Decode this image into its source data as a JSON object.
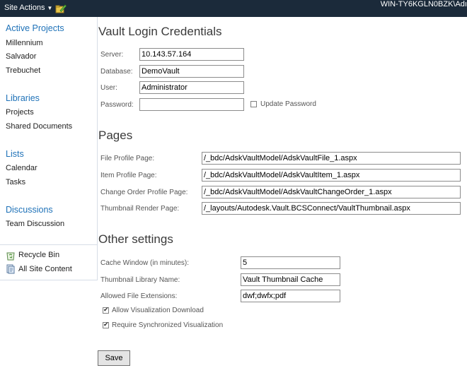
{
  "topbar": {
    "site_actions_label": "Site Actions",
    "server_name": "WIN-TY6KGLN0BZK\\Adı"
  },
  "leftnav": {
    "groups": [
      {
        "heading": "Active Projects",
        "items": [
          "Millennium",
          "Salvador",
          "Trebuchet"
        ]
      },
      {
        "heading": "Libraries",
        "items": [
          "Projects",
          "Shared Documents"
        ]
      },
      {
        "heading": "Lists",
        "items": [
          "Calendar",
          "Tasks"
        ]
      },
      {
        "heading": "Discussions",
        "items": [
          "Team Discussion"
        ]
      }
    ],
    "bottom": {
      "recycle_bin": "Recycle Bin",
      "all_site_content": "All Site Content"
    }
  },
  "vault": {
    "title": "Vault Login Credentials",
    "server_label": "Server:",
    "server_value": "10.143.57.164",
    "database_label": "Database:",
    "database_value": "DemoVault",
    "user_label": "User:",
    "user_value": "Administrator",
    "password_label": "Password:",
    "password_value": "",
    "update_password_label": "Update Password",
    "update_password_checked": false
  },
  "pages": {
    "title": "Pages",
    "file_profile_label": "File Profile Page:",
    "file_profile_value": "/_bdc/AdskVaultModel/AdskVaultFile_1.aspx",
    "item_profile_label": "Item Profile Page:",
    "item_profile_value": "/_bdc/AdskVaultModel/AdskVaultItem_1.aspx",
    "change_order_label": "Change Order Profile Page:",
    "change_order_value": "/_bdc/AdskVaultModel/AdskVaultChangeOrder_1.aspx",
    "thumbnail_render_label": "Thumbnail Render Page:",
    "thumbnail_render_value": "/_layouts/Autodesk.Vault.BCSConnect/VaultThumbnail.aspx"
  },
  "other": {
    "title": "Other settings",
    "cache_window_label": "Cache Window (in minutes):",
    "cache_window_value": "5",
    "thumbnail_library_label": "Thumbnail Library Name:",
    "thumbnail_library_value": "Vault Thumbnail Cache",
    "allowed_ext_label": "Allowed File Extensions:",
    "allowed_ext_value": "dwf;dwfx;pdf",
    "allow_viz_label": "Allow Visualization Download",
    "allow_viz_checked": true,
    "require_sync_label": "Require Synchronized Visualization",
    "require_sync_checked": true
  },
  "save_label": "Save"
}
